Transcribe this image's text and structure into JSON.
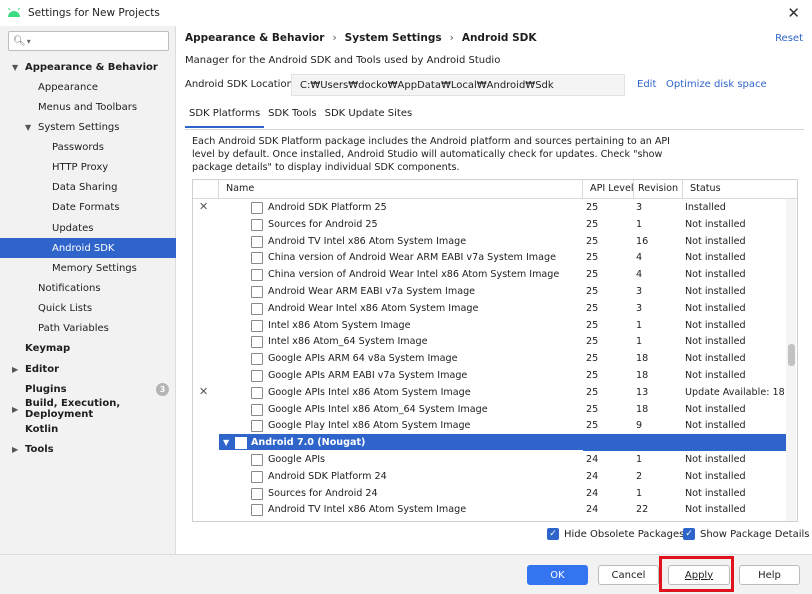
{
  "window": {
    "title": "Settings for New Projects",
    "app_icon": "android-icon",
    "close_icon": "close-icon"
  },
  "sidebar": {
    "search": {
      "placeholder": "",
      "icon": "search-icon"
    },
    "items": [
      {
        "label": "Appearance & Behavior",
        "level": 0,
        "expanded": true,
        "bold": true
      },
      {
        "label": "Appearance",
        "level": 1
      },
      {
        "label": "Menus and Toolbars",
        "level": 1
      },
      {
        "label": "System Settings",
        "level": 1,
        "expanded": true
      },
      {
        "label": "Passwords",
        "level": 2
      },
      {
        "label": "HTTP Proxy",
        "level": 2
      },
      {
        "label": "Data Sharing",
        "level": 2
      },
      {
        "label": "Date Formats",
        "level": 2
      },
      {
        "label": "Updates",
        "level": 2
      },
      {
        "label": "Android SDK",
        "level": 2,
        "selected": true
      },
      {
        "label": "Memory Settings",
        "level": 2
      },
      {
        "label": "Notifications",
        "level": 1
      },
      {
        "label": "Quick Lists",
        "level": 1
      },
      {
        "label": "Path Variables",
        "level": 1
      },
      {
        "label": "Keymap",
        "level": 0,
        "bold": true
      },
      {
        "label": "Editor",
        "level": 0,
        "bold": true,
        "collapsed": true
      },
      {
        "label": "Plugins",
        "level": 0,
        "bold": true,
        "badge": "3"
      },
      {
        "label": "Build, Execution, Deployment",
        "level": 0,
        "bold": true,
        "collapsed": true
      },
      {
        "label": "Kotlin",
        "level": 0,
        "bold": true
      },
      {
        "label": "Tools",
        "level": 0,
        "bold": true,
        "collapsed": true
      }
    ]
  },
  "header": {
    "breadcrumb": [
      "Appearance & Behavior",
      "System Settings",
      "Android SDK"
    ],
    "separator": "›",
    "reset_label": "Reset"
  },
  "main": {
    "description": "Manager for the Android SDK and Tools used by Android Studio",
    "location_label": "Android SDK Location:",
    "location_value": "C:₩Users₩docko₩AppData₩Local₩Android₩Sdk",
    "edit_label": "Edit",
    "optimize_label": "Optimize disk space",
    "tabs": [
      "SDK Platforms",
      "SDK Tools",
      "SDK Update Sites"
    ],
    "paragraph": "Each Android SDK Platform package includes the Android platform and sources pertaining to an API level by default. Once installed, Android Studio will automatically check for updates. Check \"show package details\" to display individual SDK components.",
    "columns": [
      "Name",
      "API Level",
      "Revision",
      "Status"
    ],
    "rows": [
      {
        "mark": "✕",
        "name": "Android SDK Platform 25",
        "api": "25",
        "rev": "3",
        "status": "Installed"
      },
      {
        "mark": "",
        "name": "Sources for Android 25",
        "api": "25",
        "rev": "1",
        "status": "Not installed"
      },
      {
        "mark": "",
        "name": "Android TV Intel x86 Atom System Image",
        "api": "25",
        "rev": "16",
        "status": "Not installed"
      },
      {
        "mark": "",
        "name": "China version of Android Wear ARM EABI v7a System Image",
        "api": "25",
        "rev": "4",
        "status": "Not installed"
      },
      {
        "mark": "",
        "name": "China version of Android Wear Intel x86 Atom System Image",
        "api": "25",
        "rev": "4",
        "status": "Not installed"
      },
      {
        "mark": "",
        "name": "Android Wear ARM EABI v7a System Image",
        "api": "25",
        "rev": "3",
        "status": "Not installed"
      },
      {
        "mark": "",
        "name": "Android Wear Intel x86 Atom System Image",
        "api": "25",
        "rev": "3",
        "status": "Not installed"
      },
      {
        "mark": "",
        "name": "Intel x86 Atom System Image",
        "api": "25",
        "rev": "1",
        "status": "Not installed"
      },
      {
        "mark": "",
        "name": "Intel x86 Atom_64 System Image",
        "api": "25",
        "rev": "1",
        "status": "Not installed"
      },
      {
        "mark": "",
        "name": "Google APIs ARM 64 v8a System Image",
        "api": "25",
        "rev": "18",
        "status": "Not installed"
      },
      {
        "mark": "",
        "name": "Google APIs ARM EABI v7a System Image",
        "api": "25",
        "rev": "18",
        "status": "Not installed"
      },
      {
        "mark": "✕",
        "name": "Google APIs Intel x86 Atom System Image",
        "api": "25",
        "rev": "13",
        "status": "Update Available: 18"
      },
      {
        "mark": "",
        "name": "Google APIs Intel x86 Atom_64 System Image",
        "api": "25",
        "rev": "18",
        "status": "Not installed"
      },
      {
        "mark": "",
        "name": "Google Play Intel x86 Atom System Image",
        "api": "25",
        "rev": "9",
        "status": "Not installed"
      }
    ],
    "group": {
      "name": "Android 7.0 (Nougat)"
    },
    "group_rows": [
      {
        "name": "Google APIs",
        "api": "24",
        "rev": "1",
        "status": "Not installed"
      },
      {
        "name": "Android SDK Platform 24",
        "api": "24",
        "rev": "2",
        "status": "Not installed"
      },
      {
        "name": "Sources for Android 24",
        "api": "24",
        "rev": "1",
        "status": "Not installed"
      },
      {
        "name": "Android TV Intel x86 Atom System Image",
        "api": "24",
        "rev": "22",
        "status": "Not installed"
      }
    ],
    "hide_obsolete_label": "Hide Obsolete Packages",
    "show_details_label": "Show Package Details"
  },
  "footer": {
    "ok_label": "OK",
    "cancel_label": "Cancel",
    "apply_label": "Apply",
    "help_label": "Help"
  },
  "colors": {
    "accent": "#2f65ca",
    "highlight": "#e0131d"
  }
}
